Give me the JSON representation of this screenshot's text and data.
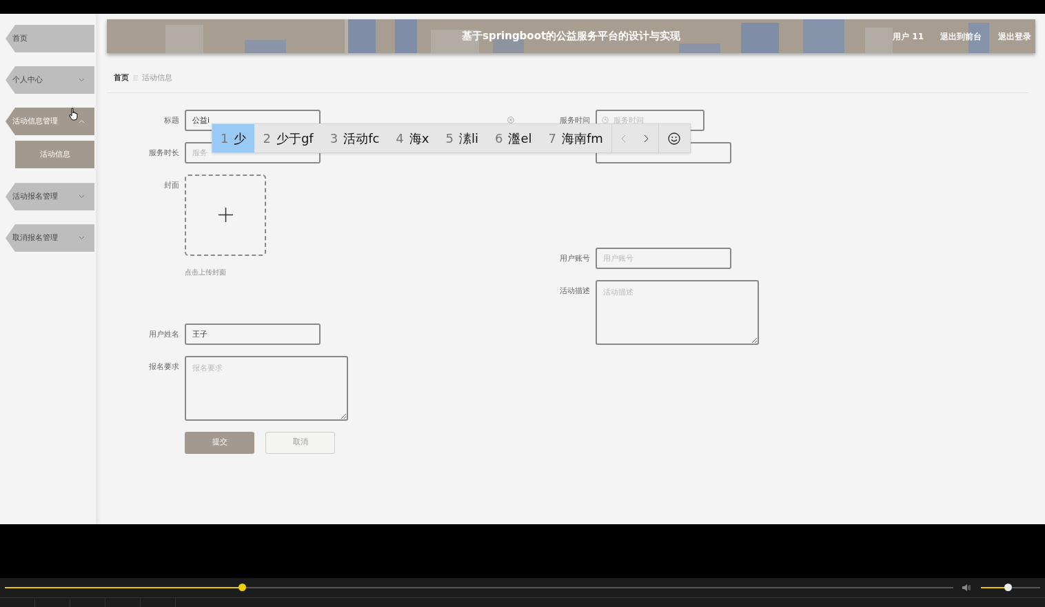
{
  "header": {
    "title": "基于springboot的公益服务平台的设计与实现",
    "user": "用户 11",
    "links": [
      "退出到前台",
      "退出登录"
    ]
  },
  "sidebar": {
    "items": [
      {
        "label": "首页",
        "kind": "link",
        "selected": false
      },
      {
        "label": "个人中心",
        "kind": "group",
        "selected": false,
        "expanded": false
      },
      {
        "label": "活动信息管理",
        "kind": "group",
        "selected": true,
        "expanded": true,
        "children": [
          {
            "label": "活动信息",
            "selected": true
          }
        ]
      },
      {
        "label": "活动报名管理",
        "kind": "group",
        "selected": false,
        "expanded": false
      },
      {
        "label": "取消报名管理",
        "kind": "group",
        "selected": false,
        "expanded": false
      }
    ]
  },
  "breadcrumb": [
    "首页",
    "活动信息"
  ],
  "form": {
    "left": [
      {
        "label": "标题",
        "kind": "input",
        "value": "公益i",
        "clearable": true
      },
      {
        "label": "服务时长",
        "kind": "input",
        "placeholder": "服务"
      },
      {
        "label": "封面",
        "kind": "upload",
        "hint": "点击上传封面"
      },
      {
        "label": "用户姓名",
        "kind": "input",
        "value": "王子"
      },
      {
        "label": "报名要求",
        "kind": "textarea",
        "placeholder": "报名要求"
      }
    ],
    "right": [
      {
        "label": "服务时间",
        "kind": "date",
        "placeholder": "服务时间"
      },
      {
        "kind": "input"
      },
      {
        "label": "用户账号",
        "kind": "input",
        "placeholder": "用户账号"
      },
      {
        "label": "活动描述",
        "kind": "textarea",
        "placeholder": "活动描述"
      }
    ],
    "buttons": [
      {
        "label": "提交",
        "kind": "primary"
      },
      {
        "label": "取消",
        "kind": "secondary"
      }
    ]
  },
  "ime": {
    "candidates": [
      {
        "number": "1",
        "text": "少",
        "selected": true
      },
      {
        "number": "2",
        "text": "少于gf",
        "selected": false
      },
      {
        "number": "3",
        "text": "活动fc",
        "selected": false
      },
      {
        "number": "4",
        "text": "海x",
        "selected": false
      },
      {
        "number": "5",
        "text": "溸li",
        "selected": false
      },
      {
        "number": "6",
        "text": "瀊el",
        "selected": false
      },
      {
        "number": "7",
        "text": "海南fm",
        "selected": false
      }
    ]
  },
  "player": {
    "progress": {
      "level": 0.25
    },
    "volume": {
      "level": 0.45
    }
  }
}
